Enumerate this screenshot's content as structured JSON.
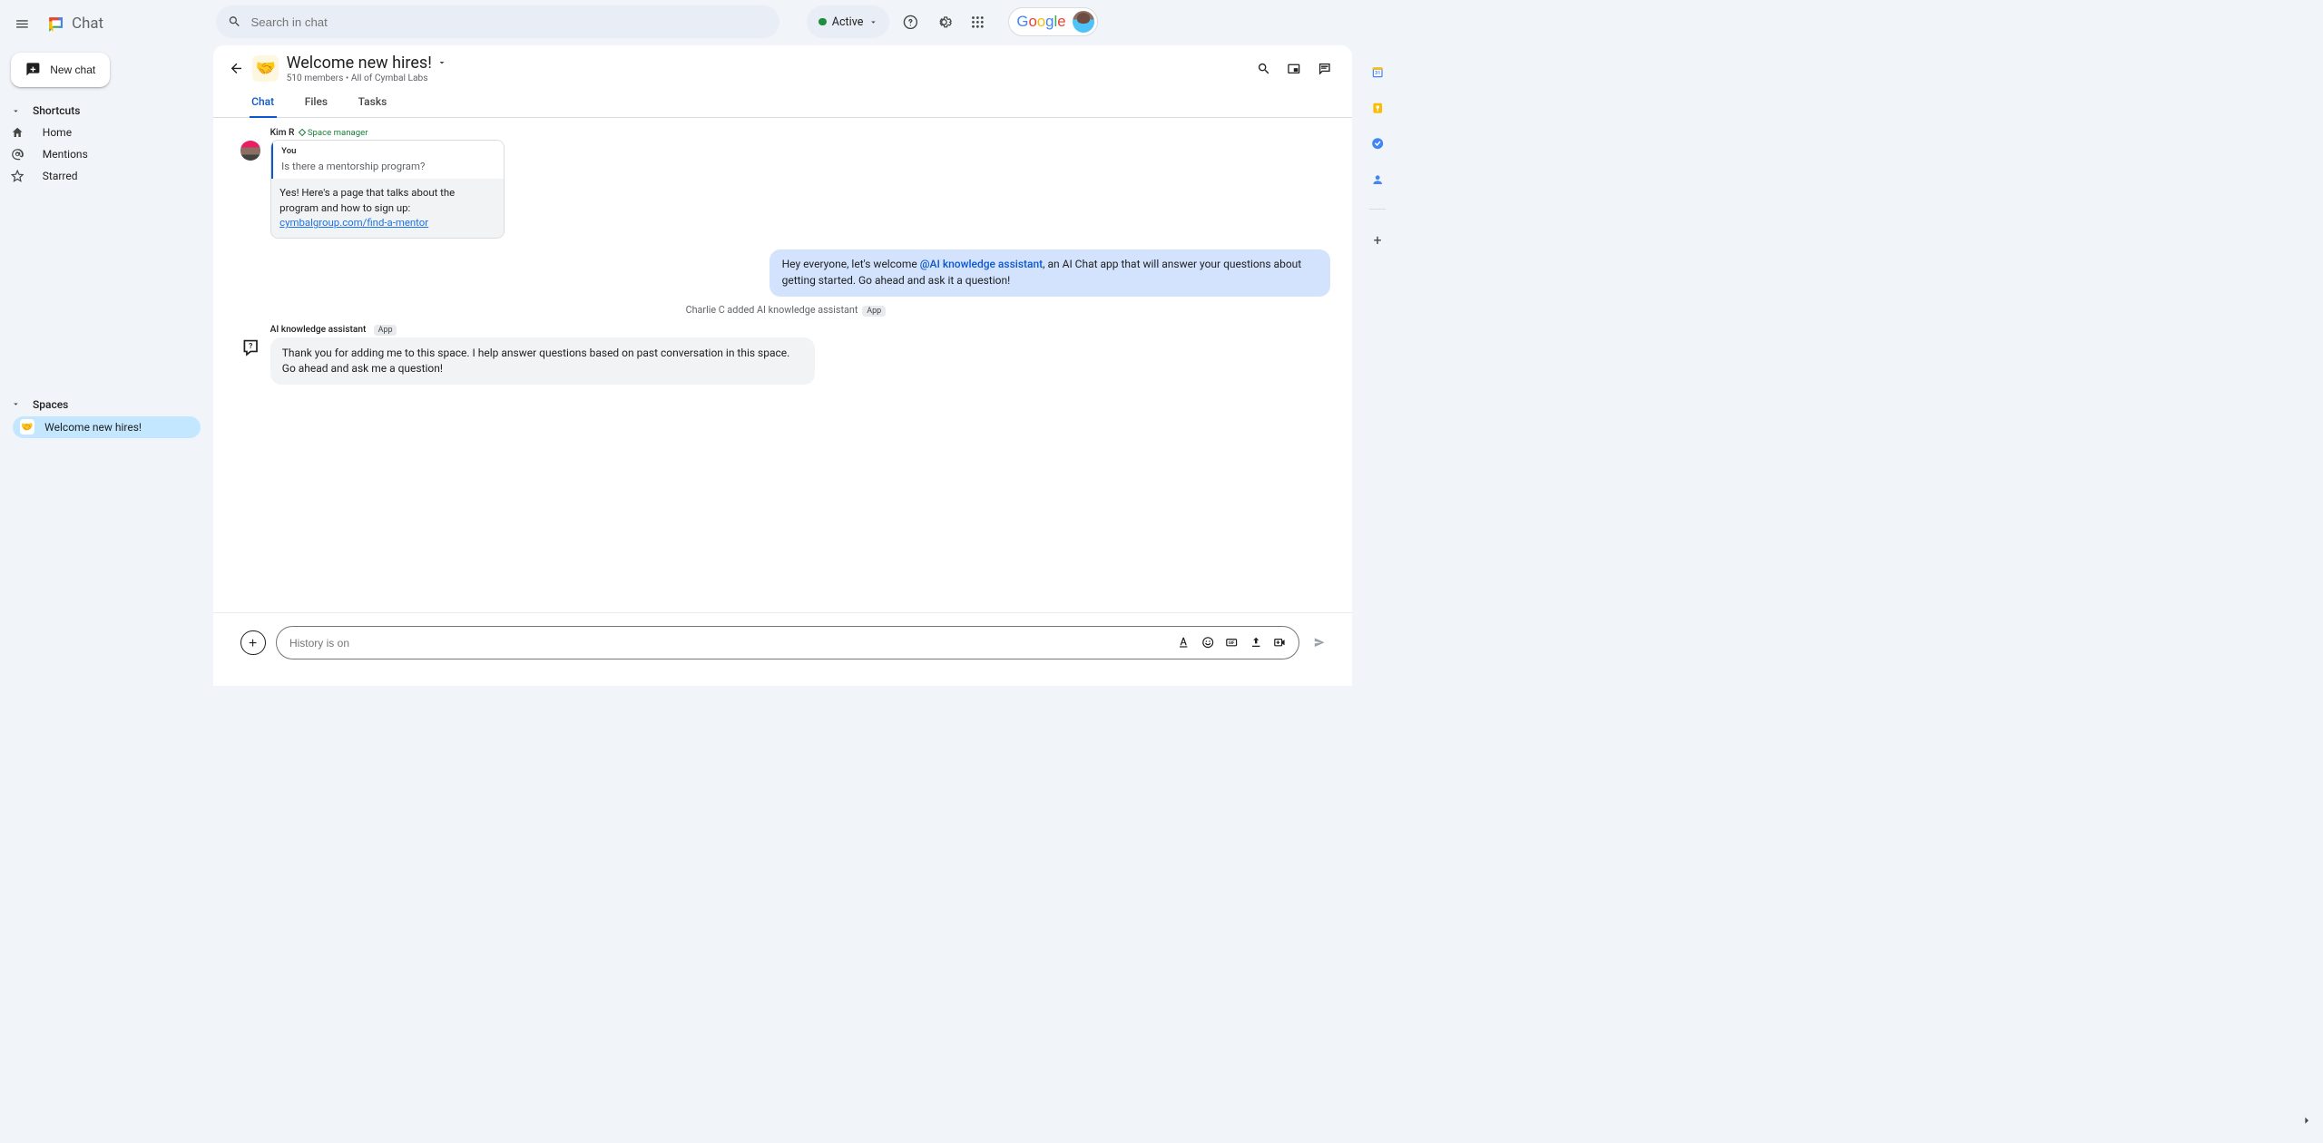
{
  "app": {
    "name": "Chat"
  },
  "new_chat_label": "New chat",
  "search_placeholder": "Search in chat",
  "status_label": "Active",
  "sidebar": {
    "shortcuts_label": "Shortcuts",
    "shortcuts": [
      {
        "label": "Home"
      },
      {
        "label": "Mentions"
      },
      {
        "label": "Starred"
      }
    ],
    "spaces_label": "Spaces",
    "spaces": [
      {
        "label": "Welcome new hires!",
        "emoji": "🤝",
        "active": true
      }
    ]
  },
  "space": {
    "emoji": "🤝",
    "title": "Welcome new hires!",
    "subtitle": "510 members  •  All of Cymbal Labs",
    "tabs": [
      {
        "label": "Chat",
        "active": true
      },
      {
        "label": "Files"
      },
      {
        "label": "Tasks"
      }
    ]
  },
  "messages": {
    "kim": {
      "author": "Kim R",
      "role": "Space manager",
      "quote_author": "You",
      "quote_text": "Is there a mentorship program?",
      "answer_pre": "Yes! Here's a page that talks about the program and how to sign up: ",
      "answer_link": "cymbalgroup.com/find-a-mentor"
    },
    "own": {
      "pre": "Hey everyone, let's welcome ",
      "mention": "@AI knowledge assistant",
      "post": ", an AI Chat app that will answer your questions about getting started.  Go ahead and ask it a question!"
    },
    "system": {
      "text": "Charlie C added AI knowledge assistant",
      "badge": "App"
    },
    "bot": {
      "author": "AI knowledge assistant",
      "badge": "App",
      "text": "Thank you for adding me to this space. I help answer questions based on past conversation in this space. Go ahead and ask me a question!"
    }
  },
  "compose": {
    "placeholder": "History is on"
  }
}
